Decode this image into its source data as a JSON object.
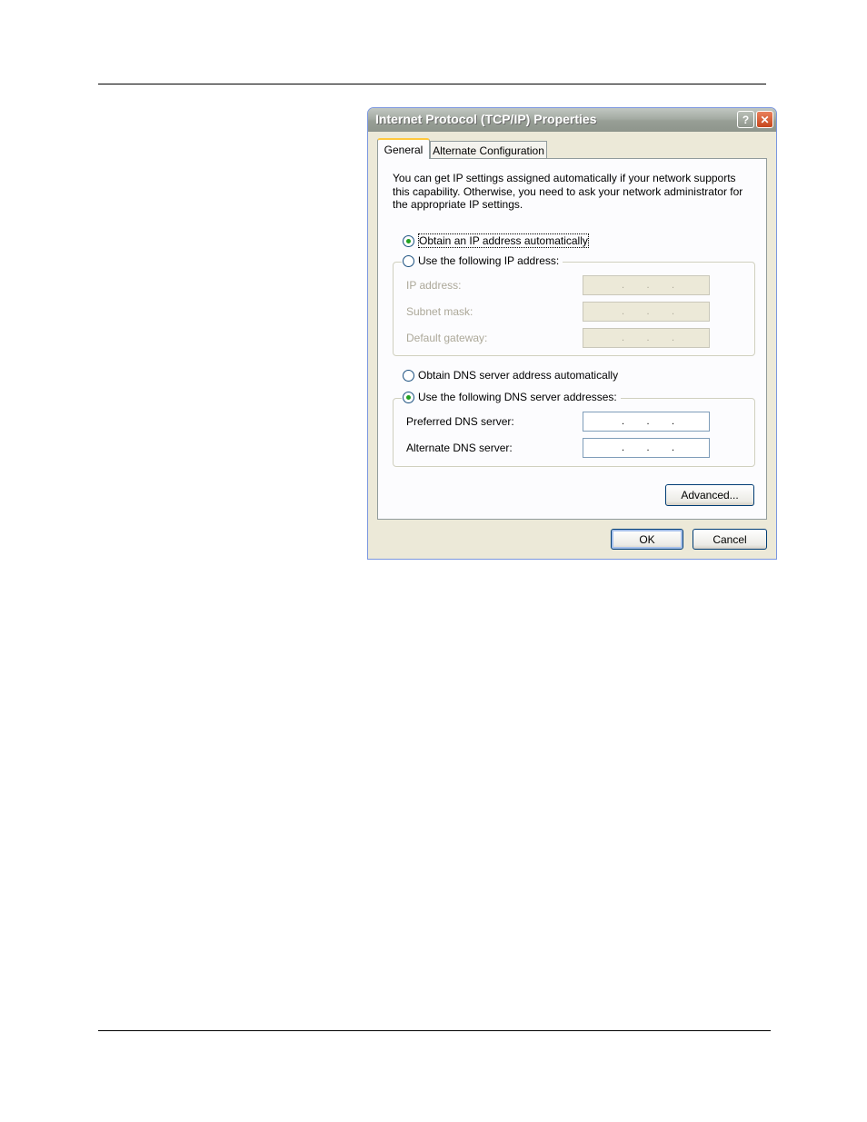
{
  "dialog": {
    "title": "Internet Protocol (TCP/IP) Properties",
    "help_label": "?",
    "close_label": "✕"
  },
  "tabs": [
    {
      "label": "General",
      "active": true
    },
    {
      "label": "Alternate Configuration",
      "active": false
    }
  ],
  "description": "You can get IP settings assigned automatically if your network supports this capability. Otherwise, you need to ask your network administrator for the appropriate IP settings.",
  "ip_options": {
    "auto_label": "Obtain an IP address automatically",
    "auto_selected": true,
    "manual_label": "Use the following IP address:",
    "manual_selected": false,
    "fields": [
      {
        "label": "IP address:",
        "value": ".        .        ."
      },
      {
        "label": "Subnet mask:",
        "value": ".        .        ."
      },
      {
        "label": "Default gateway:",
        "value": ".        .        ."
      }
    ]
  },
  "dns_options": {
    "auto_label": "Obtain DNS server address automatically",
    "auto_selected": false,
    "manual_label": "Use the following DNS server addresses:",
    "manual_selected": true,
    "fields": [
      {
        "label": "Preferred DNS server:",
        "value": ".        .        ."
      },
      {
        "label": "Alternate DNS server:",
        "value": ".        .        ."
      }
    ]
  },
  "buttons": {
    "advanced": "Advanced...",
    "ok": "OK",
    "cancel": "Cancel"
  },
  "colors": {
    "radio_selected": "#21a121",
    "tab_highlight": "#ffc83c"
  }
}
